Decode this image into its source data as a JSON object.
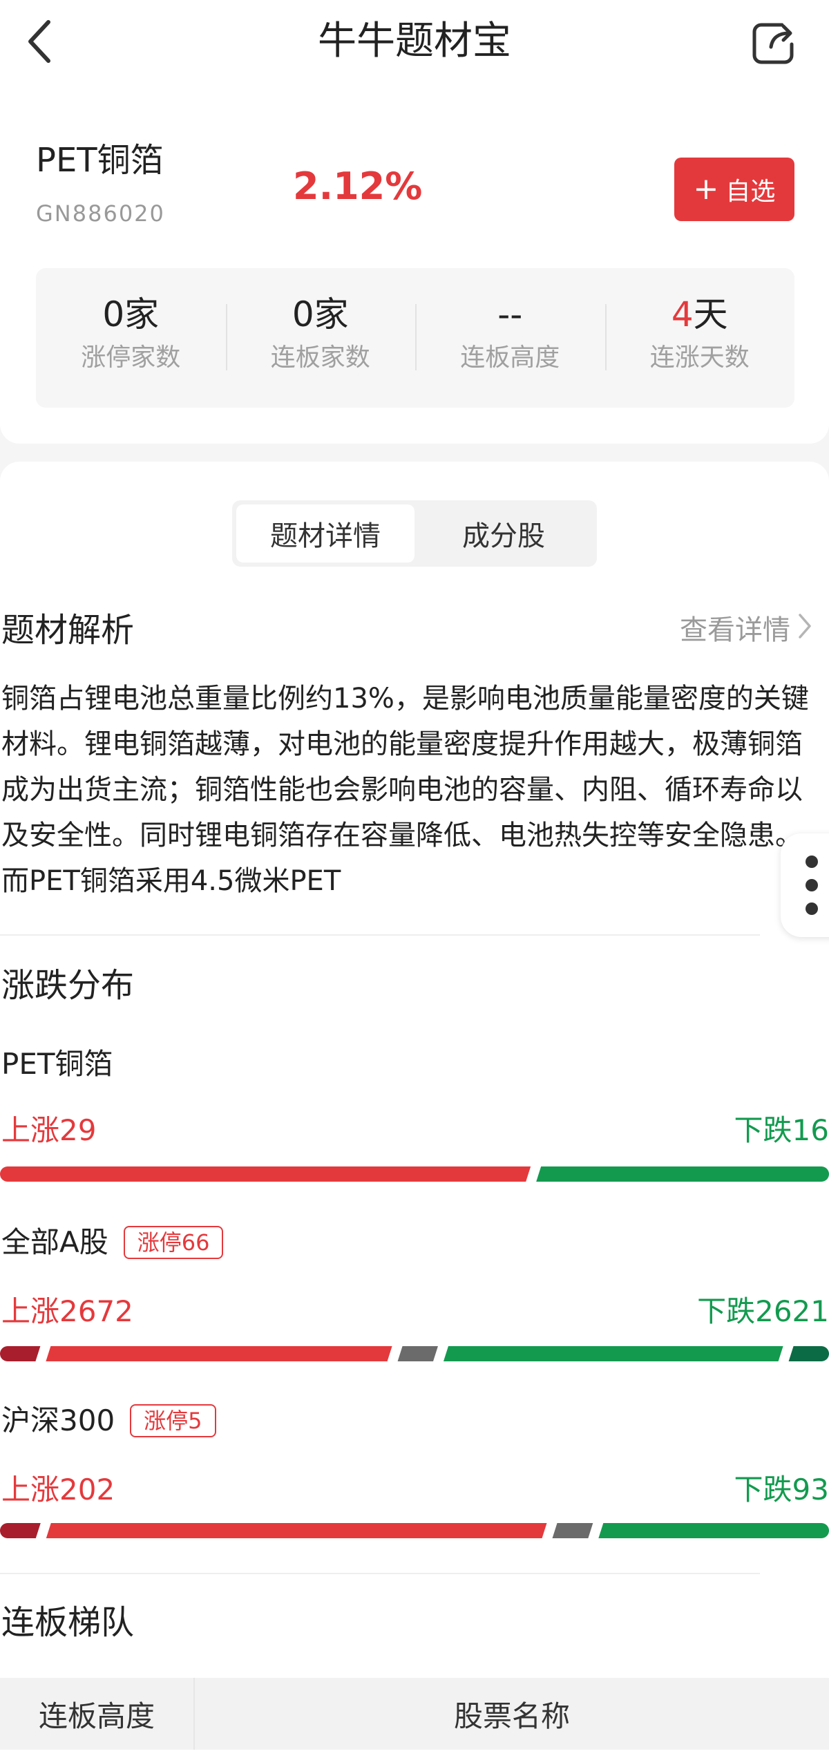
{
  "header": {
    "title": "牛牛题材宝"
  },
  "concept": {
    "name": "PET铜箔",
    "code": "GN886020",
    "change": "2.12%",
    "add_label": "自选"
  },
  "stats": [
    {
      "value": "0",
      "unit": "家",
      "label": "涨停家数"
    },
    {
      "value": "0",
      "unit": "家",
      "label": "连板家数"
    },
    {
      "value": "--",
      "unit": "",
      "label": "连板高度"
    },
    {
      "value": "4",
      "unit": "天",
      "label": "连涨天数"
    }
  ],
  "tabs": [
    {
      "label": "题材详情",
      "active": true
    },
    {
      "label": "成分股",
      "active": false
    }
  ],
  "analysis": {
    "title": "题材解析",
    "view_detail": "查看详情",
    "text": "铜箔占锂电池总重量比例约13%，是影响电池质量能量密度的关键材料。锂电铜箔越薄，对电池的能量密度提升作用越大，极薄铜箔成为出货主流；铜箔性能也会影响电池的容量、内阻、循环寿命以及安全性。同时锂电铜箔存在容量降低、电池热失控等安全隐患。而PET铜箔采用4.5微米PET"
  },
  "distribution": {
    "title": "涨跌分布",
    "groups": [
      {
        "name": "PET铜箔",
        "badge": "",
        "up_label": "上涨29",
        "down_label": "下跌16",
        "up": 29,
        "down": 16,
        "limit_up_share": 0,
        "flat_share": 0,
        "limit_down_share": 0
      },
      {
        "name": "全部A股",
        "badge": "涨停66",
        "up_label": "上涨2672",
        "down_label": "下跌2621",
        "up": 2672,
        "down": 2621,
        "limit_up_share": 0.05,
        "flat_share": 0.05,
        "limit_down_share": 0.05
      },
      {
        "name": "沪深300",
        "badge": "涨停5",
        "up_label": "上涨202",
        "down_label": "下跌93",
        "up": 202,
        "down": 93,
        "limit_up_share": 0.05,
        "flat_share": 0.05,
        "limit_down_share": 0
      }
    ]
  },
  "ladder": {
    "title": "连板梯队",
    "col_height": "连板高度",
    "col_name": "股票名称"
  },
  "colors": {
    "red": "#e4393c",
    "dark_red": "#a91e2c",
    "green": "#139a4f",
    "dark_green": "#0b6b45",
    "flat_gray": "#6b6b6b"
  }
}
